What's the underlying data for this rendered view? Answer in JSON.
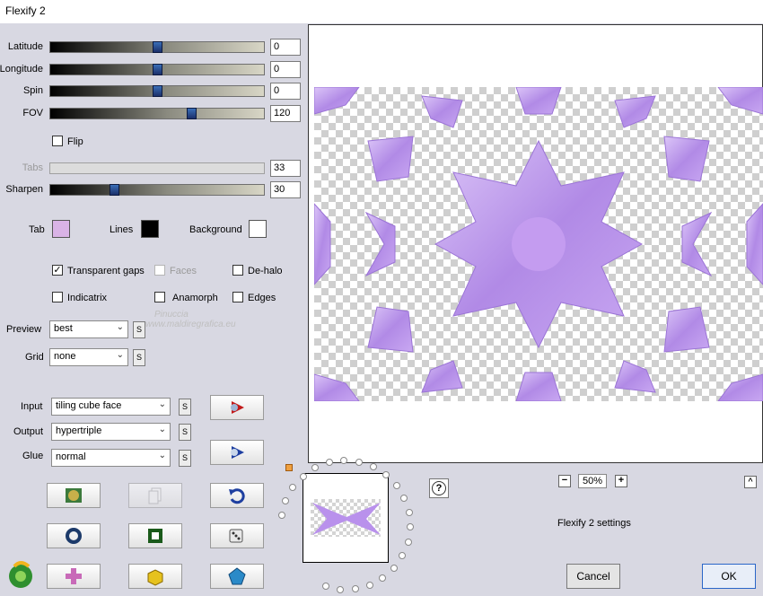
{
  "window": {
    "title": "Flexify 2"
  },
  "sliders": [
    {
      "label": "Latitude",
      "value": "0",
      "level": 0.5,
      "disabled": false
    },
    {
      "label": "Longitude",
      "value": "0",
      "level": 0.5,
      "disabled": false
    },
    {
      "label": "Spin",
      "value": "0",
      "level": 0.5,
      "disabled": false
    },
    {
      "label": "FOV",
      "value": "120",
      "level": 0.66,
      "disabled": false
    },
    {
      "label": "Tabs",
      "value": "33",
      "level": 0.0,
      "disabled": true
    },
    {
      "label": "Sharpen",
      "value": "30",
      "level": 0.3,
      "disabled": false
    }
  ],
  "flip": {
    "label": "Flip",
    "checked": false
  },
  "colors": {
    "tab": {
      "label": "Tab",
      "color": "#d9b3e6"
    },
    "lines": {
      "label": "Lines",
      "color": "#000000"
    },
    "background": {
      "label": "Background",
      "color": "#ffffff"
    }
  },
  "options": {
    "transparent_gaps": {
      "label": "Transparent gaps",
      "checked": true
    },
    "faces": {
      "label": "Faces",
      "checked": false,
      "disabled": true
    },
    "de_halo": {
      "label": "De-halo",
      "checked": false
    },
    "indicatrix": {
      "label": "Indicatrix",
      "checked": false
    },
    "anamorph": {
      "label": "Anamorph",
      "checked": false
    },
    "edges": {
      "label": "Edges",
      "checked": false
    }
  },
  "preview": {
    "label": "Preview",
    "value": "best"
  },
  "grid": {
    "label": "Grid",
    "value": "none"
  },
  "s_label": "S",
  "input": {
    "label": "Input",
    "value": "tiling cube face"
  },
  "output": {
    "label": "Output",
    "value": "hypertriple"
  },
  "glue": {
    "label": "Glue",
    "value": "normal"
  },
  "watermark": {
    "line1": "Pinuccia",
    "line2": "www.maldiregrafica.eu"
  },
  "zoom": {
    "value": "50%",
    "minus": "−",
    "plus": "+"
  },
  "settings_label": "Flexify 2 settings",
  "buttons": {
    "cancel": "Cancel",
    "ok": "OK",
    "help": "?",
    "collapse": "^"
  },
  "accent": "#b58be8"
}
